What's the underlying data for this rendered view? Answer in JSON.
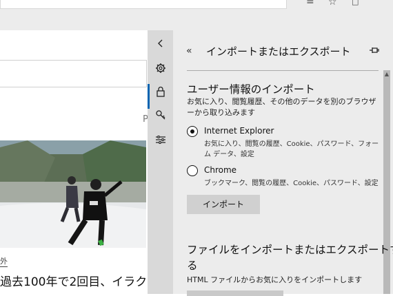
{
  "panel": {
    "title": "インポートまたはエクスポート",
    "import_section": {
      "heading": "ユーザー情報のインポート",
      "description": "お気に入り、閲覧履歴、その他のデータを別のブラウザーから取り込みます",
      "options": [
        {
          "label": "Internet Explorer",
          "detail": "お気に入り、閲覧の履歴、Cookie、パスワード、フォーム データ、設定",
          "selected": true
        },
        {
          "label": "Chrome",
          "detail": "ブックマーク、閲覧の履歴、Cookie、パスワード、設定",
          "selected": false
        }
      ],
      "button_label": "インポート"
    },
    "file_section": {
      "heading_line1": "ファイルをインポートまたはエクスポートす",
      "heading_line2": "る",
      "description": "HTML ファイルからお気に入りをインポートします"
    }
  },
  "rail": {
    "items": [
      "collapse-icon",
      "gear-icon",
      "lock-icon",
      "key-icon",
      "sliders-icon"
    ],
    "active": "gear-icon",
    "accent": "#0063b1"
  },
  "background_page": {
    "side_letter": "P",
    "category": "外",
    "headline": "過去100年で2回目、イラク"
  }
}
